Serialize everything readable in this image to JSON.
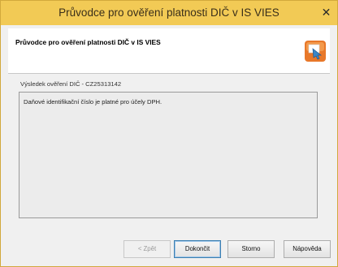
{
  "window": {
    "title": "Průvodce pro ověření platnosti DIČ v IS VIES",
    "close_symbol": "✕"
  },
  "header": {
    "title": "Průvodce pro ověření platnosti DIČ v IS VIES",
    "icon": "wizard-arrow-icon"
  },
  "result": {
    "label": "Výsledek ověření DIČ - CZ25313142",
    "text": "Daňové identifikační číslo je platné pro účely DPH."
  },
  "buttons": {
    "back": "< Zpět",
    "finish": "Dokončit",
    "cancel": "Storno",
    "help": "Nápověda"
  },
  "colors": {
    "titlebar": "#f2ca55",
    "icon_orange": "#e8782a",
    "icon_blue": "#3a86c8"
  }
}
